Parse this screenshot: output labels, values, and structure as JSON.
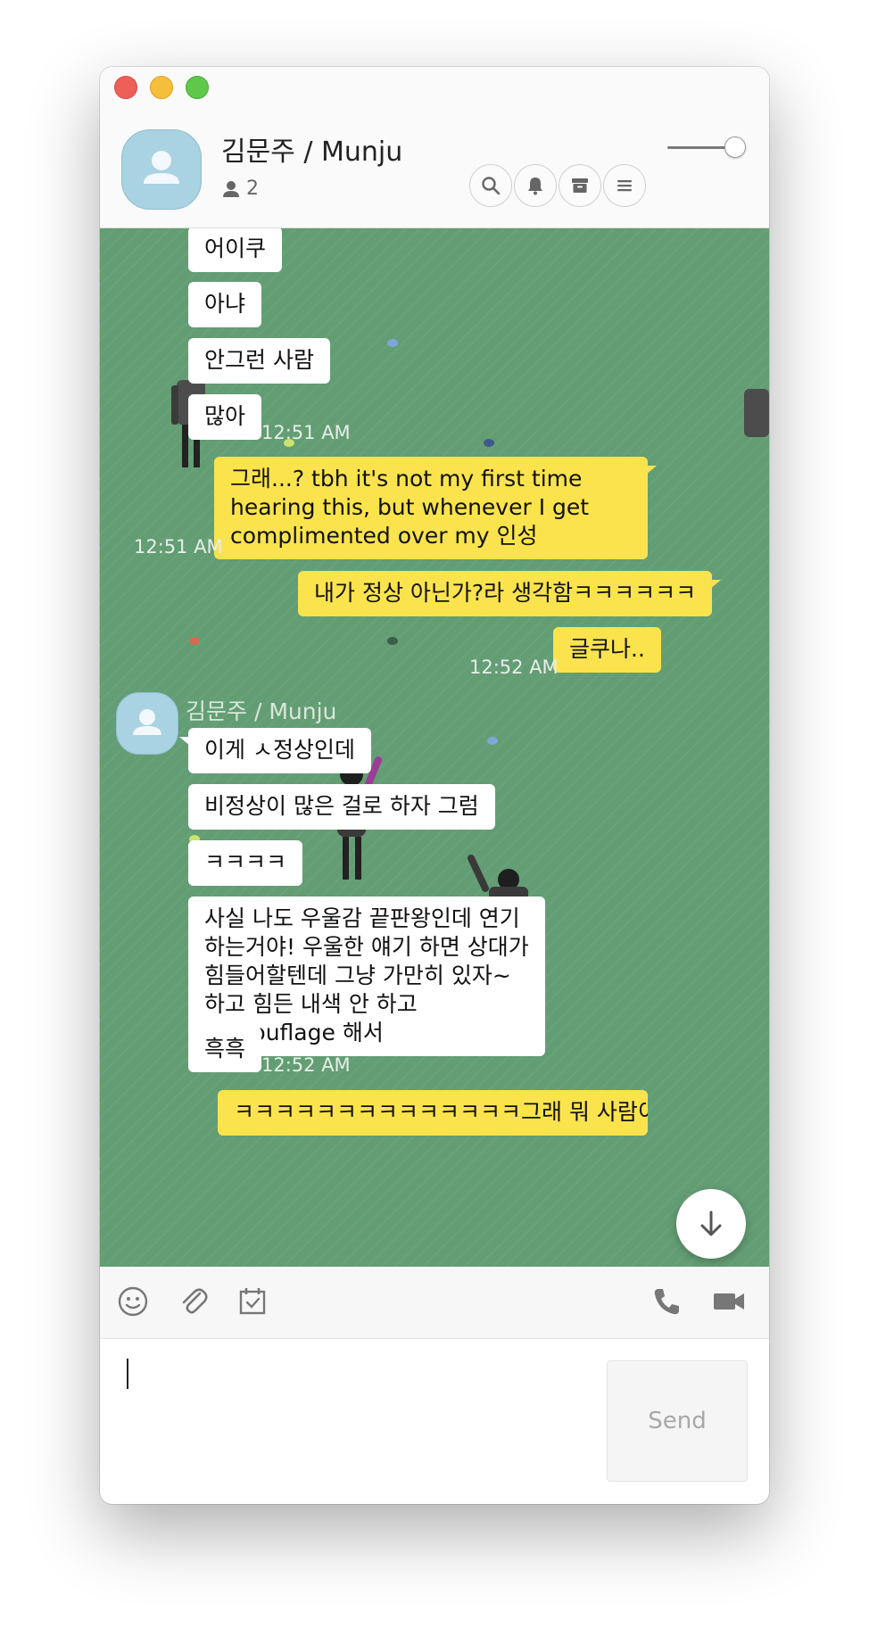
{
  "window": {
    "title": "김문주 / Munju",
    "member_count": "2"
  },
  "header_buttons": [
    "search-icon",
    "bell-icon",
    "archive-icon",
    "menu-icon"
  ],
  "messages": [
    {
      "dir": "in",
      "text": "어이쿠"
    },
    {
      "dir": "in",
      "text": "아냐"
    },
    {
      "dir": "in",
      "text": "안그런 사람"
    },
    {
      "dir": "in",
      "text": "많아",
      "time": "12:51 AM"
    },
    {
      "dir": "out",
      "text": "그래...? tbh it's not my first time hearing this, but whenever I get complimented over my 인성",
      "time": "12:51 AM"
    },
    {
      "dir": "out",
      "text": "내가 정상 아닌가?라 생각함ㅋㅋㅋㅋㅋㅋ"
    },
    {
      "dir": "out",
      "text": "글쿠나..",
      "time": "12:52 AM"
    },
    {
      "dir": "in",
      "sender": "김문주 / Munju",
      "text": "이게 ㅅ정상인데"
    },
    {
      "dir": "in",
      "text": "비정상이 많은 걸로 하자 그럼"
    },
    {
      "dir": "in",
      "text": "ㅋㅋㅋㅋ"
    },
    {
      "dir": "in",
      "text": "사실 나도 우울감 끝판왕인데 연기하는거야! 우울한 얘기 하면 상대가 힘들어할텐데 그냥 가만히 있자~ 하고 힘든 내색 안 하고 camouflage 해서"
    },
    {
      "dir": "in",
      "text": "흑흑",
      "time": "12:52 AM"
    },
    {
      "dir": "out",
      "text": "ㅋㅋㅋㅋㅋㅋㅋㅋㅋㅋㅋㅋㅋㅋ그래 뭐 사람이 장점 하나쯤"
    }
  ],
  "toolbar": {
    "left": [
      "emoji-icon",
      "attachment-icon",
      "calendar-icon"
    ],
    "right": [
      "phone-icon",
      "video-icon"
    ]
  },
  "composer": {
    "value": "",
    "send_label": "Send"
  },
  "colors": {
    "chat_bg": "#639d73",
    "bubble_in": "#ffffff",
    "bubble_out": "#fae34c",
    "avatar": "#a9d2e2"
  }
}
